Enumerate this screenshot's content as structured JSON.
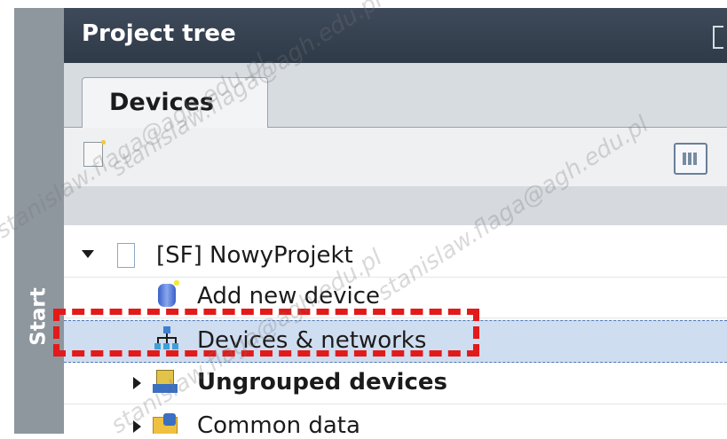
{
  "sidebar": {
    "start_label": "Start"
  },
  "panel": {
    "title": "Project tree"
  },
  "tabs": [
    {
      "label": "Devices",
      "active": true
    }
  ],
  "tree": {
    "project": {
      "label": "[SF] NowyProjekt",
      "expanded": true
    },
    "items": [
      {
        "label": "Add new device",
        "icon": "add-device-icon",
        "bold": false
      },
      {
        "label": "Devices & networks",
        "icon": "devices-networks-icon",
        "bold": false,
        "selected": true
      },
      {
        "label": "Ungrouped devices",
        "icon": "ungrouped-devices-icon",
        "bold": true,
        "expandable": true
      },
      {
        "label": "Common data",
        "icon": "common-data-icon",
        "bold": false,
        "expandable": true
      }
    ]
  },
  "annotation": {
    "highlight_color": "#e21a1a"
  },
  "watermark": {
    "text": "stanislaw.flaga@agh.edu.pl"
  }
}
